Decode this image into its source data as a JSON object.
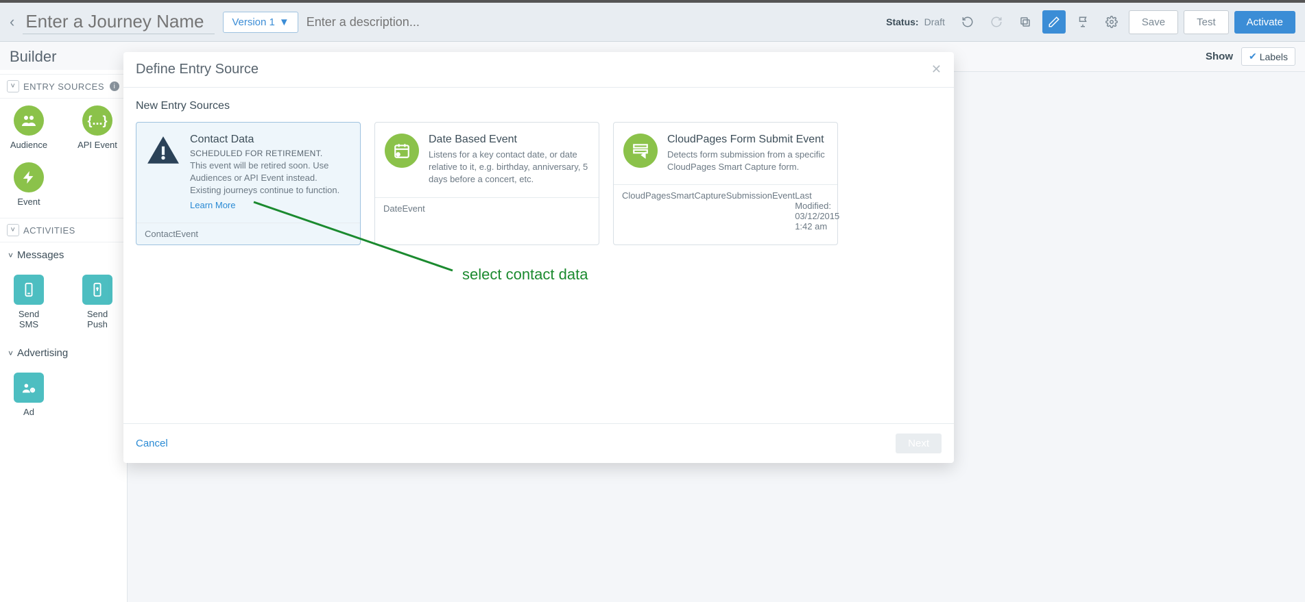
{
  "header": {
    "journey_name_placeholder": "Enter a Journey Name",
    "version_label": "Version 1",
    "description_placeholder": "Enter a description...",
    "status_label": "Status:",
    "status_value": "Draft",
    "save_label": "Save",
    "test_label": "Test",
    "activate_label": "Activate"
  },
  "secondary": {
    "builder_title": "Builder",
    "show_label": "Show",
    "labels_label": "Labels"
  },
  "sidebar": {
    "entry_sources_header": "ENTRY SOURCES",
    "audience_label": "Audience",
    "api_event_label": "API Event",
    "event_label": "Event",
    "activities_header": "ACTIVITIES",
    "messages_header": "Messages",
    "send_sms_label": "Send SMS",
    "send_push_label": "Send Push",
    "advertising_header": "Advertising",
    "ad_label": "Ad"
  },
  "modal": {
    "title": "Define Entry Source",
    "body_title": "New Entry Sources",
    "cancel_label": "Cancel",
    "next_label": "Next",
    "cards": [
      {
        "title": "Contact Data",
        "subtitle": "SCHEDULED FOR RETIREMENT.",
        "description": "This event will be retired soon. Use Audiences or API Event instead. Existing journeys continue to function.",
        "learn_more": "Learn More",
        "footer_left": "ContactEvent"
      },
      {
        "title": "Date Based Event",
        "description": "Listens for a key contact date, or date relative to it, e.g. birthday, anniversary, 5 days before a concert, etc.",
        "footer_left": "DateEvent"
      },
      {
        "title": "CloudPages Form Submit Event",
        "description": "Detects form submission from a specific CloudPages Smart Capture form.",
        "footer_left": "CloudPagesSmartCaptureSubmissionEvent",
        "footer_right": "Last Modified: 03/12/2015 1:42 am"
      }
    ]
  },
  "annotation": {
    "text": "select contact data"
  }
}
